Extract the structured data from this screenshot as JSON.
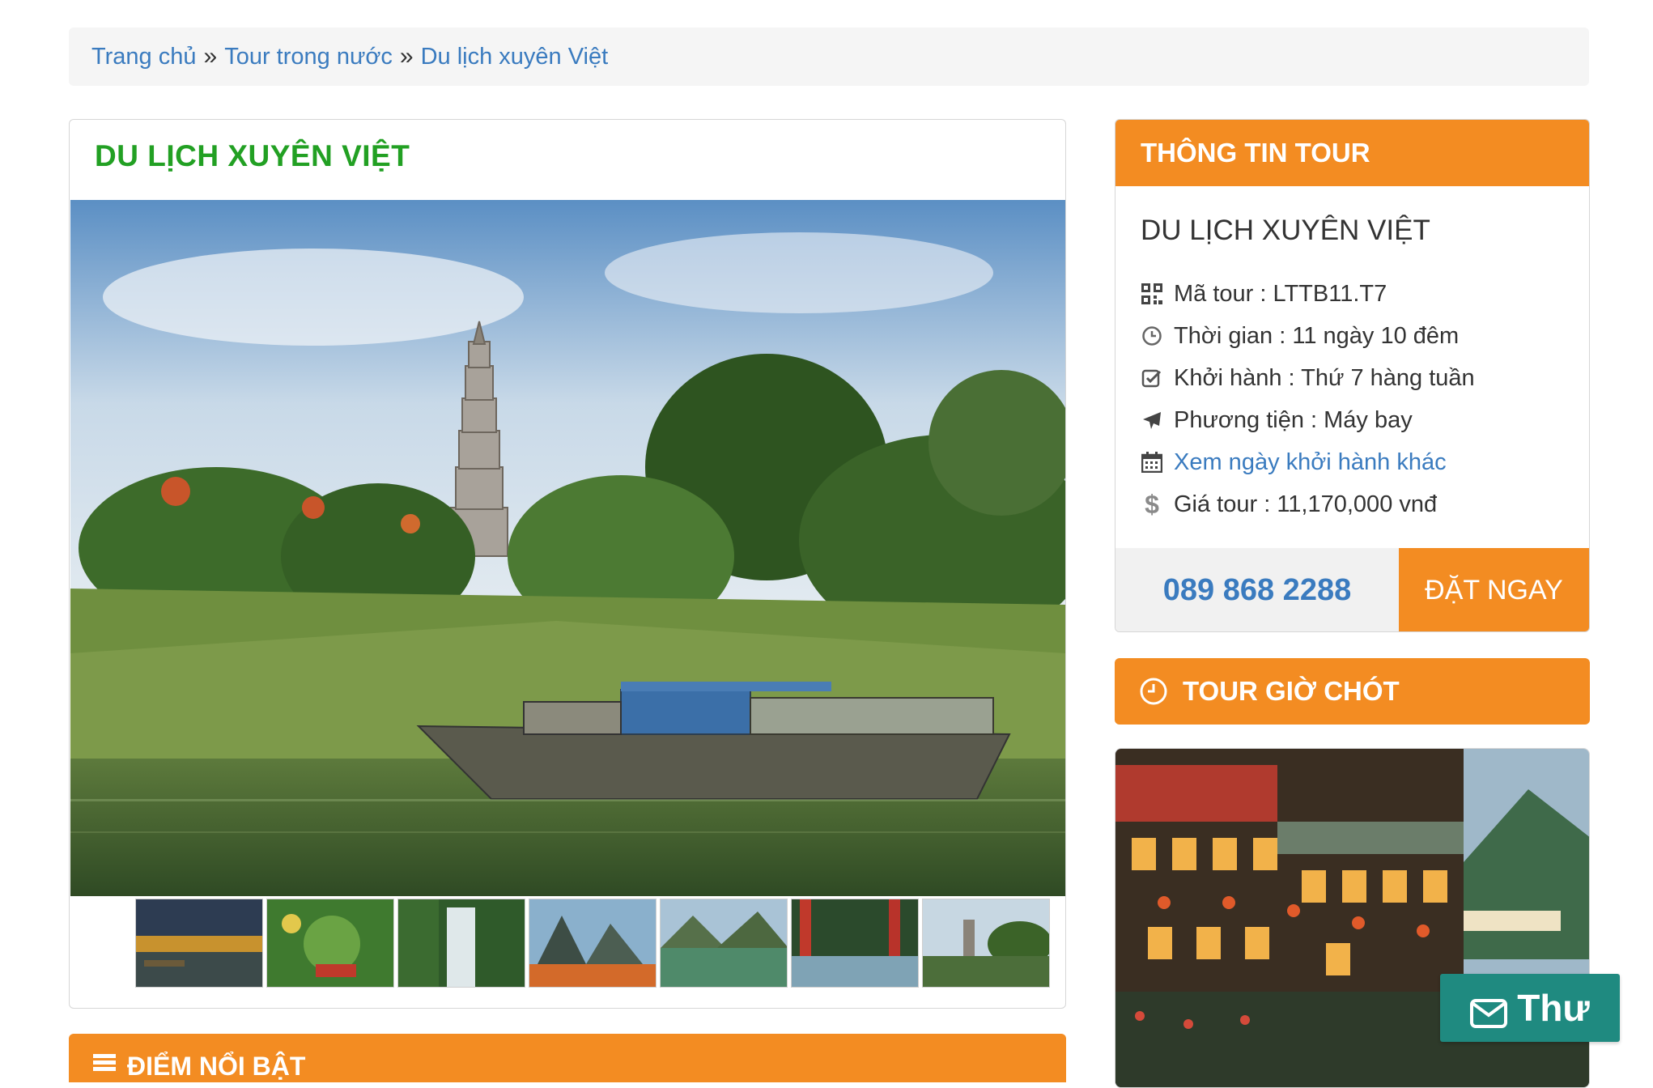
{
  "breadcrumb": {
    "items": [
      "Trang chủ",
      "Tour trong nước",
      "Du lịch xuyên Việt"
    ],
    "separator": "»"
  },
  "tour": {
    "title": "DU LỊCH XUYÊN VIỆT"
  },
  "highlight": {
    "label": "ĐIỂM NỔI BẬT"
  },
  "info": {
    "header": "THÔNG TIN TOUR",
    "name": "DU LỊCH XUYÊN VIỆT",
    "items": [
      {
        "icon": "qrcode-icon",
        "text": "Mã tour : LTTB11.T7"
      },
      {
        "icon": "clock-icon",
        "text": "Thời gian : 11 ngày 10 đêm"
      },
      {
        "icon": "check-square-icon",
        "text": "Khởi hành : Thứ 7 hàng tuần"
      },
      {
        "icon": "plane-icon",
        "text": "Phương tiện : Máy bay"
      },
      {
        "icon": "calendar-icon",
        "text": "Xem ngày khởi hành khác"
      },
      {
        "icon": "dollar-icon",
        "text": "Giá tour : 11,170,000 vnđ"
      }
    ],
    "phone": "089 868 2288",
    "book_label": "ĐẶT NGAY"
  },
  "last_minute": {
    "label": "TOUR GIỜ CHÓT"
  },
  "mail": {
    "label": "Thư"
  },
  "colors": {
    "accent": "#f38c22",
    "title_green": "#22a023",
    "link_blue": "#3a7bbf",
    "mail_teal": "#1f8a80"
  }
}
